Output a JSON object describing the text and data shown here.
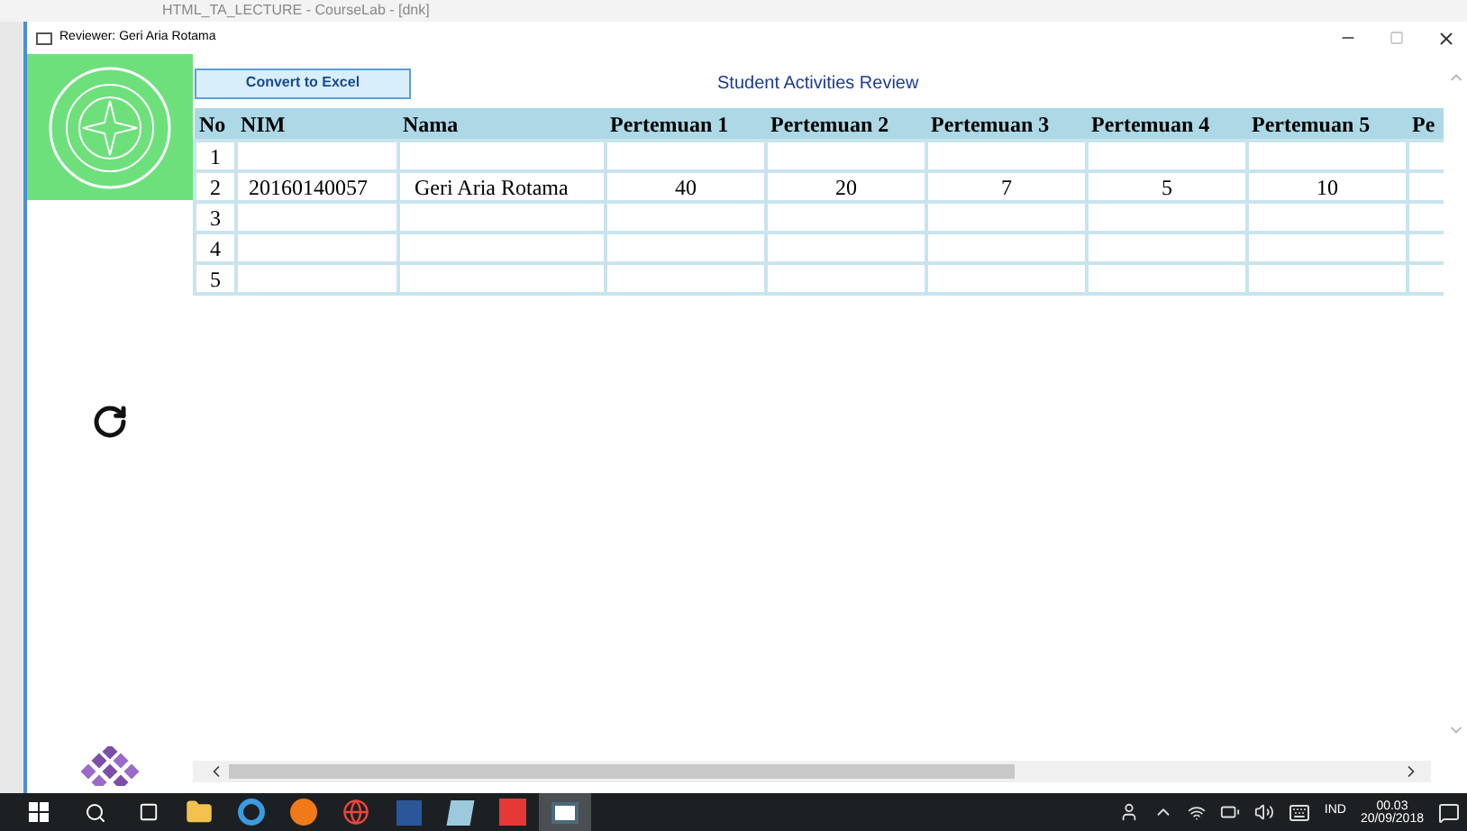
{
  "background_app": {
    "title": "HTML_TA_LECTURE - CourseLab - [dnk]"
  },
  "window": {
    "title": "Reviewer: Geri Aria Rotama"
  },
  "toolbar": {
    "button": "Convert to Excel",
    "heading": "Student Activities Review"
  },
  "table": {
    "columns": [
      "No",
      "NIM",
      "Nama",
      "Pertemuan 1",
      "Pertemuan 2",
      "Pertemuan 3",
      "Pertemuan 4",
      "Pertemuan 5",
      "Pe"
    ],
    "rows": [
      {
        "no": "1"
      },
      {
        "no": "2",
        "nim": "20160140057",
        "nama": "Geri Aria Rotama",
        "pertemuan": [
          "40",
          "20",
          "7",
          "5",
          "10"
        ]
      },
      {
        "no": "3"
      },
      {
        "no": "4"
      },
      {
        "no": "5"
      }
    ]
  },
  "taskbar": {
    "apps": [
      {
        "kind": "explorer",
        "selected": false
      },
      {
        "kind": "ie",
        "selected": false
      },
      {
        "kind": "firefox",
        "selected": false
      },
      {
        "kind": "chrome",
        "selected": false
      },
      {
        "kind": "word",
        "selected": false
      },
      {
        "kind": "notes",
        "selected": false
      },
      {
        "kind": "courselab",
        "selected": false
      },
      {
        "kind": "reviewer",
        "selected": true
      }
    ],
    "language": "IND",
    "time": "00.03",
    "date": "20/09/2018"
  }
}
